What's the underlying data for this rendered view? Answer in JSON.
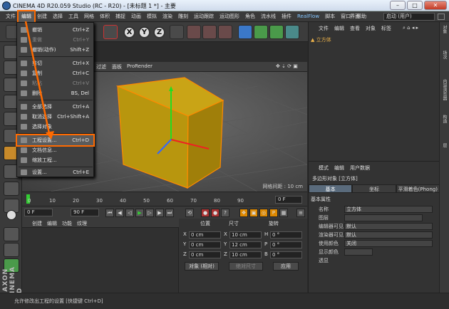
{
  "title": "CINEMA 4D R20.059 Studio (RC - R20) - [未标题 1 *] - 主要",
  "window_buttons": {
    "min": "–",
    "max": "□",
    "close": "✕"
  },
  "menubar": [
    "文件",
    "编辑",
    "创建",
    "选择",
    "工具",
    "网格",
    "体积",
    "捕捉",
    "动画",
    "模拟",
    "渲染",
    "雕刻",
    "运动跟踪",
    "运动图形",
    "角色",
    "流水线",
    "插件",
    "RealFlow",
    "脚本",
    "窗口",
    "帮助"
  ],
  "layout": {
    "label": "界面:",
    "value": "启动 (用户)"
  },
  "toolbar": {
    "axes": [
      "X",
      "Y",
      "Z"
    ]
  },
  "viewport": {
    "menus": [
      "过滤",
      "面板",
      "ProRender"
    ],
    "grid_label": "网格间距 : 10 cm"
  },
  "edit_menu": [
    {
      "label": "撤销",
      "shortcut": "Ctrl+Z",
      "enabled": true
    },
    {
      "label": "重做",
      "shortcut": "Ctrl+Y",
      "enabled": false
    },
    {
      "label": "撤销(动作)",
      "shortcut": "Shift+Z",
      "enabled": true
    },
    {
      "label": "剪切",
      "shortcut": "Ctrl+X",
      "enabled": true
    },
    {
      "label": "复制",
      "shortcut": "Ctrl+C",
      "enabled": true
    },
    {
      "label": "粘贴",
      "shortcut": "Ctrl+V",
      "enabled": false
    },
    {
      "label": "删除",
      "shortcut": "BS, Del",
      "enabled": true
    },
    {
      "label": "全部选择",
      "shortcut": "Ctrl+A",
      "enabled": true
    },
    {
      "label": "取消选择",
      "shortcut": "Ctrl+Shift+A",
      "enabled": true
    },
    {
      "label": "选择对象",
      "shortcut": "",
      "enabled": true
    },
    {
      "label": "工程设置...",
      "shortcut": "Ctrl+D",
      "enabled": true,
      "highlighted": true
    },
    {
      "label": "文档信息...",
      "shortcut": "",
      "enabled": true
    },
    {
      "label": "缩放工程...",
      "shortcut": "",
      "enabled": true
    },
    {
      "label": "设置...",
      "shortcut": "Ctrl+E",
      "enabled": true
    }
  ],
  "timeline": {
    "ticks": [
      "0",
      "10",
      "20",
      "30",
      "40",
      "50",
      "60",
      "70",
      "80",
      "90"
    ],
    "end_field": "0 F"
  },
  "playbar": {
    "start": "0 F",
    "current": "90 F",
    "end": "90 F"
  },
  "material_menu": [
    "创建",
    "编辑",
    "功能",
    "纹理"
  ],
  "coordinates": {
    "headers": [
      "位置",
      "尺寸",
      "旋转"
    ],
    "rows": [
      {
        "pl": "X",
        "pv": "0 cm",
        "sl": "X",
        "sv": "10 cm",
        "rl": "H",
        "rv": "0 °"
      },
      {
        "pl": "Y",
        "pv": "0 cm",
        "sl": "Y",
        "sv": "12 cm",
        "rl": "P",
        "rv": "0 °"
      },
      {
        "pl": "Z",
        "pv": "0 cm",
        "sl": "Z",
        "sv": "10 cm",
        "rl": "B",
        "rv": "0 °"
      }
    ],
    "mode": "对象 (相对)",
    "size_mode": "绝对尺寸",
    "apply": "应用"
  },
  "object_manager": {
    "menus": [
      "文件",
      "编辑",
      "查看",
      "对象",
      "标签"
    ],
    "object": "立方体"
  },
  "right_strip": [
    "对象",
    "场次",
    "内容浏览器",
    "构造",
    "层"
  ],
  "attributes": {
    "menus": [
      "模式",
      "编辑",
      "用户数据"
    ],
    "object_title": "多边形对象 [立方体]",
    "tabs": [
      "基本",
      "坐标",
      "平滑着色(Phong)"
    ],
    "section": "基本属性",
    "rows": [
      {
        "k": "名称",
        "v": "立方体"
      },
      {
        "k": "图层",
        "v": ""
      },
      {
        "k": "编辑器可见",
        "v": "默认"
      },
      {
        "k": "渲染器可见",
        "v": "默认"
      },
      {
        "k": "使用颜色",
        "v": "关闭"
      },
      {
        "k": "显示颜色",
        "v": ""
      },
      {
        "k": "透显",
        "v": ""
      }
    ]
  },
  "status": "允许修改出工程的设置 [快捷键 Ctrl+D]"
}
